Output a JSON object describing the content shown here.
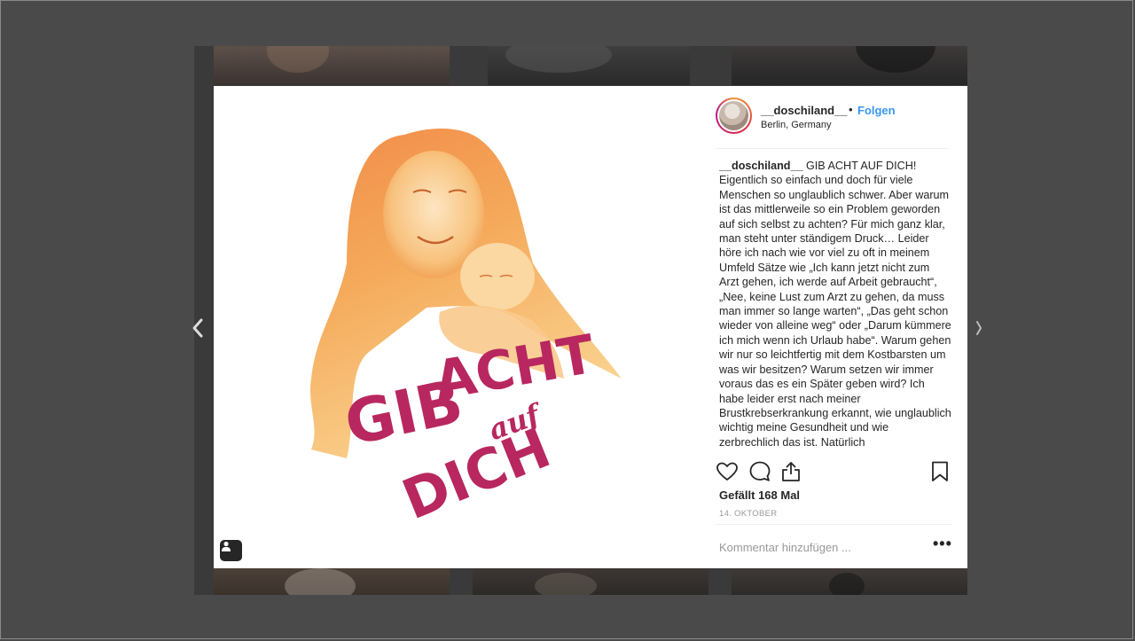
{
  "post": {
    "username": "__doschiland__",
    "separator": "•",
    "follow_label": "Folgen",
    "location": "Berlin, Germany",
    "caption_user": "__doschiland__",
    "caption_text": "GIB ACHT AUF DICH! Eigentlich so einfach und doch für viele Menschen so unglaublich schwer. Aber warum ist das mittlerweile so ein Problem geworden auf sich selbst zu achten? Für mich ganz klar, man steht unter ständigem Druck… Leider höre ich nach wie vor viel zu oft in meinem Umfeld Sätze wie „Ich kann jetzt nicht zum Arzt gehen, ich werde auf Arbeit gebraucht“, „Nee, keine Lust zum Arzt zu gehen, da muss man immer so lange warten“, „Das geht schon wieder von alleine weg“ oder „Darum kümmere ich mich wenn ich Urlaub habe“. Warum gehen wir nur so leichtfertig mit dem Kostbarsten um was wir besitzen? Warum setzen wir immer voraus das es ein Später geben wird? Ich habe leider erst nach meiner Brustkrebserkrankung erkannt, wie unglaublich wichtig meine Gesundheit und wie zerbrechlich das ist. Natürlich",
    "likes": "Gefällt 168 Mal",
    "date": "14. OKTOBER",
    "comment_placeholder": "Kommentar hinzufügen ...",
    "more_label": "•••"
  },
  "image": {
    "lettering": [
      "GIB",
      "ACHT",
      "auf",
      "DICH"
    ],
    "colors": {
      "lettering": "#b8275f",
      "watercolor_light": "#f7c16a",
      "watercolor_dark": "#e8652d"
    }
  },
  "icons": {
    "like": "heart-icon",
    "comment": "comment-icon",
    "share": "share-icon",
    "save": "bookmark-icon",
    "tag": "user-tag-icon",
    "prev": "chevron-left-icon",
    "next": "chevron-right-icon"
  },
  "colors": {
    "link": "#3897f0",
    "overlay": "#4a4a4a"
  }
}
